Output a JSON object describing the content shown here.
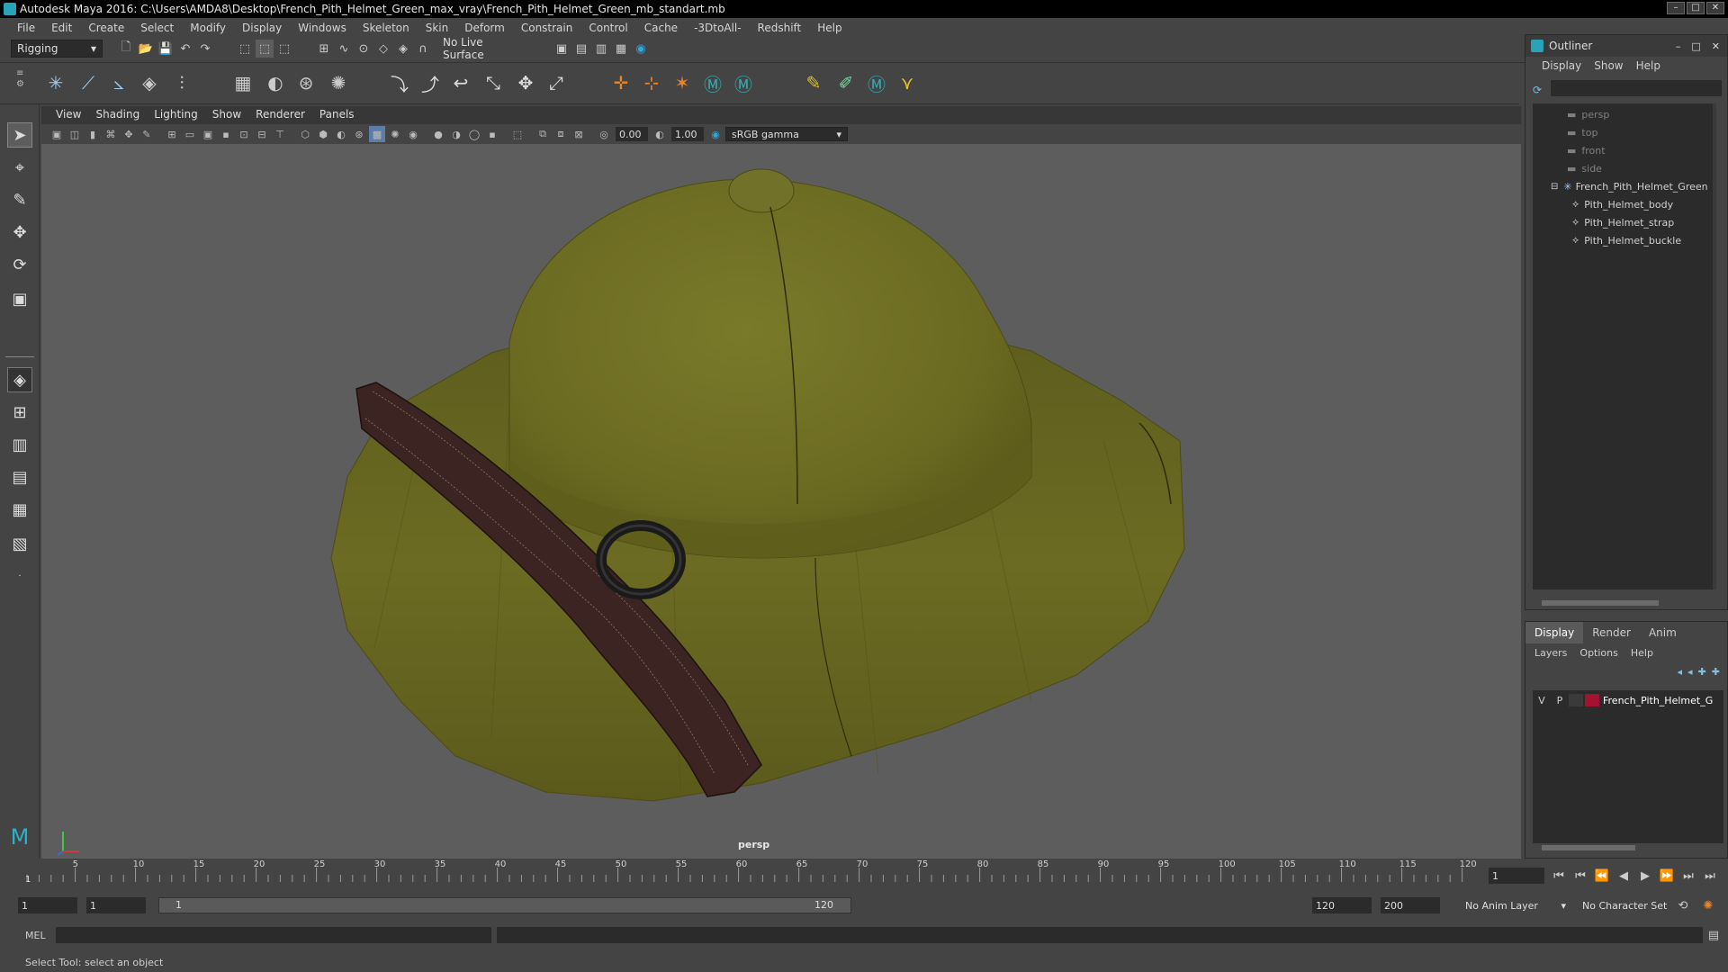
{
  "window": {
    "title": "Autodesk Maya 2016: C:\\Users\\AMDA8\\Desktop\\French_Pith_Helmet_Green_max_vray\\French_Pith_Helmet_Green_mb_standart.mb"
  },
  "menubar": [
    "File",
    "Edit",
    "Create",
    "Select",
    "Modify",
    "Display",
    "Windows",
    "Skeleton",
    "Skin",
    "Deform",
    "Constrain",
    "Control",
    "Cache",
    "-3DtoAll-",
    "Redshift",
    "Help"
  ],
  "statusline": {
    "mode": "Rigging",
    "live_surface": "No Live Surface"
  },
  "viewport": {
    "menu": [
      "View",
      "Shading",
      "Lighting",
      "Show",
      "Renderer",
      "Panels"
    ],
    "exposure": "0.00",
    "gamma": "1.00",
    "color_space": "sRGB gamma",
    "camera_label": "persp"
  },
  "timeline": {
    "ticks": [
      "5",
      "10",
      "15",
      "20",
      "25",
      "30",
      "35",
      "40",
      "45",
      "50",
      "55",
      "60",
      "65",
      "70",
      "75",
      "80",
      "85",
      "90",
      "95",
      "100",
      "105",
      "110",
      "115",
      "120"
    ],
    "start_tick": "1",
    "current_frame": "1"
  },
  "range": {
    "start": "1",
    "playback_start": "1",
    "slider_start": "1",
    "slider_end": "120",
    "playback_end": "120",
    "end": "200",
    "anim_layer": "No Anim Layer",
    "character_set": "No Character Set"
  },
  "cmdline": {
    "lang": "MEL"
  },
  "helpline": {
    "text": "Select Tool: select an object"
  },
  "outliner": {
    "title": "Outliner",
    "menu": [
      "Display",
      "Show",
      "Help"
    ],
    "items": [
      {
        "label": "persp"
      },
      {
        "label": "top"
      },
      {
        "label": "front"
      },
      {
        "label": "side"
      },
      {
        "label": "French_Pith_Helmet_Green"
      },
      {
        "label": "Pith_Helmet_body"
      },
      {
        "label": "Pith_Helmet_strap"
      },
      {
        "label": "Pith_Helmet_buckle"
      }
    ]
  },
  "layers": {
    "tabs": [
      "Display",
      "Render",
      "Anim"
    ],
    "menu": [
      "Layers",
      "Options",
      "Help"
    ],
    "row": {
      "v": "V",
      "p": "P",
      "name": "French_Pith_Helmet_G",
      "color": "#a3122f"
    }
  },
  "colors": {
    "helmet": "#6b6a22",
    "strap": "#3b2421",
    "viewport_bg": "#5d5d5d"
  }
}
